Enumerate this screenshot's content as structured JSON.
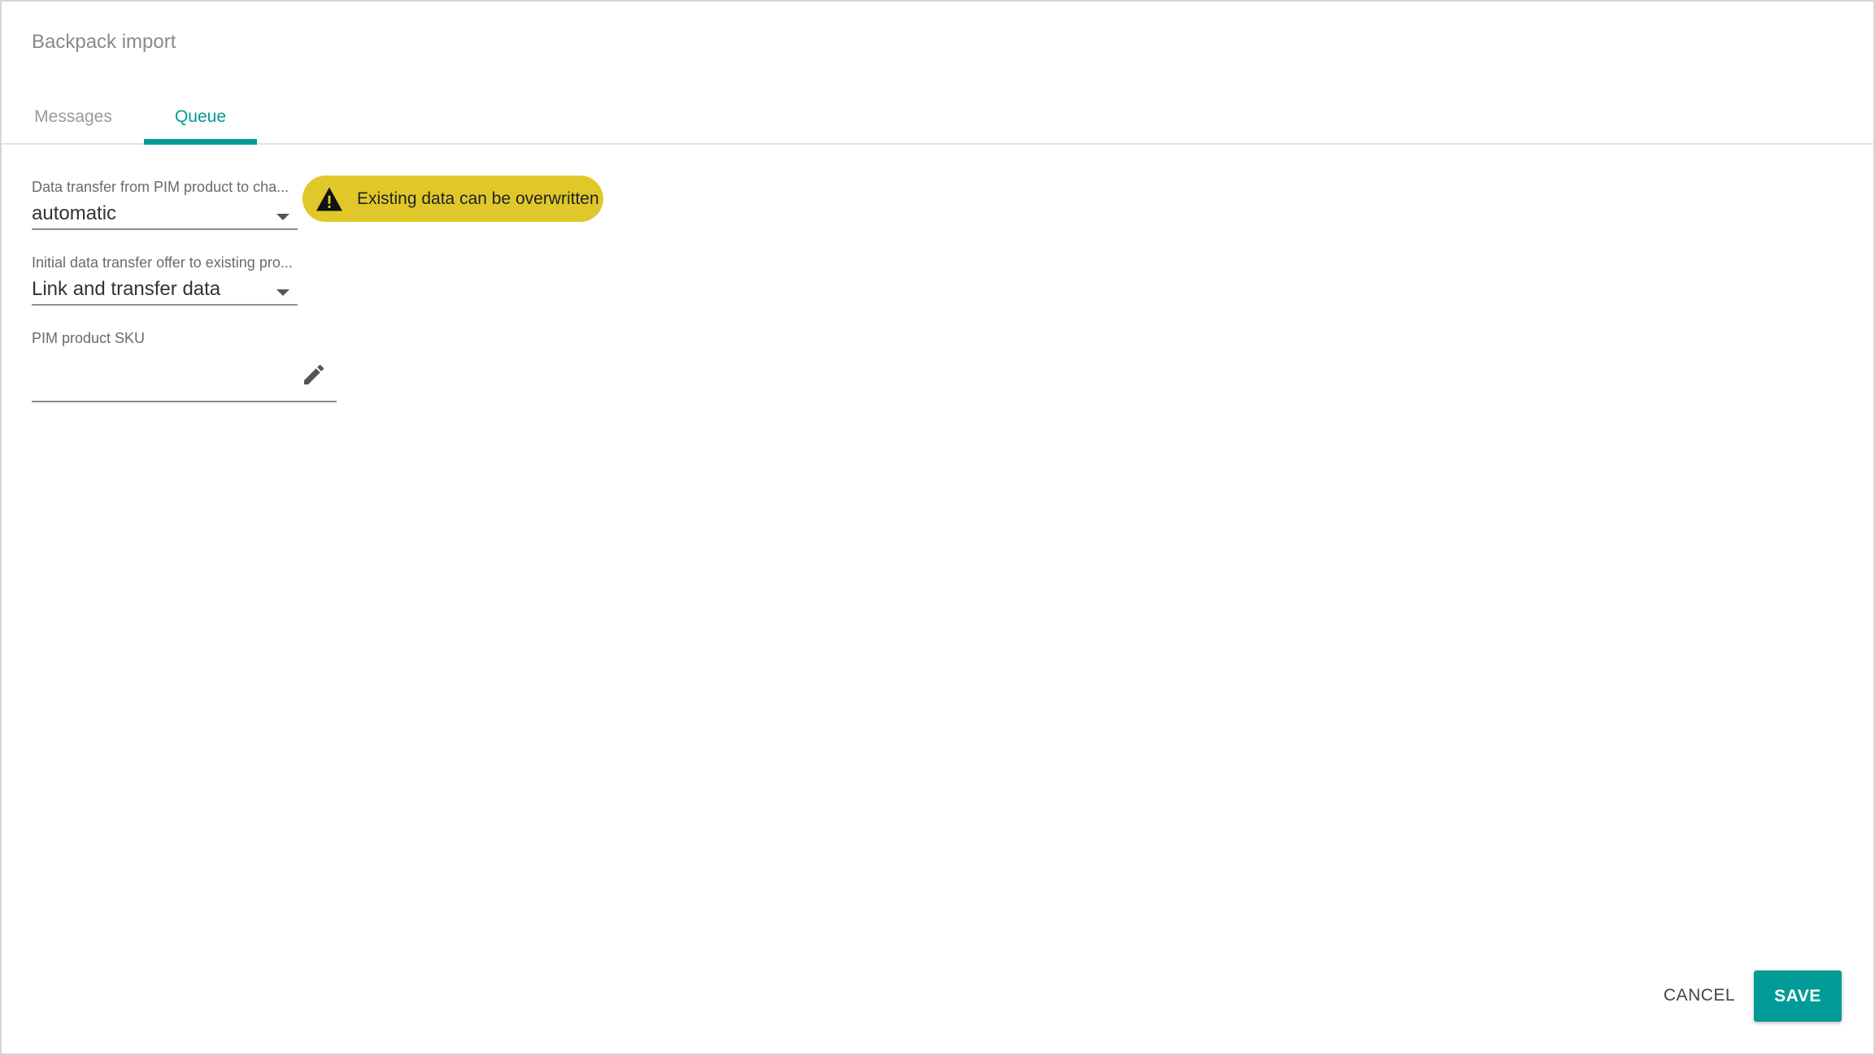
{
  "dialog": {
    "title": "Backpack import"
  },
  "tabs": [
    {
      "label": "Messages",
      "active": false
    },
    {
      "label": "Queue",
      "active": true
    }
  ],
  "form": {
    "data_transfer": {
      "label": "Data transfer from PIM product to cha...",
      "value": "automatic",
      "icon": "chevron-down-icon"
    },
    "initial_transfer": {
      "label": "Initial data transfer offer to existing pro...",
      "value": "Link and transfer data",
      "icon": "chevron-down-icon"
    },
    "sku": {
      "label": "PIM product SKU",
      "value": "",
      "icon": "pencil-icon"
    }
  },
  "warning": {
    "text": "Existing data can be overwritten",
    "icon": "warning-icon",
    "color": "#e0c82a"
  },
  "actions": {
    "cancel_label": "CANCEL",
    "save_label": "SAVE"
  },
  "colors": {
    "accent": "#009b96",
    "warning": "#e0c82a"
  }
}
